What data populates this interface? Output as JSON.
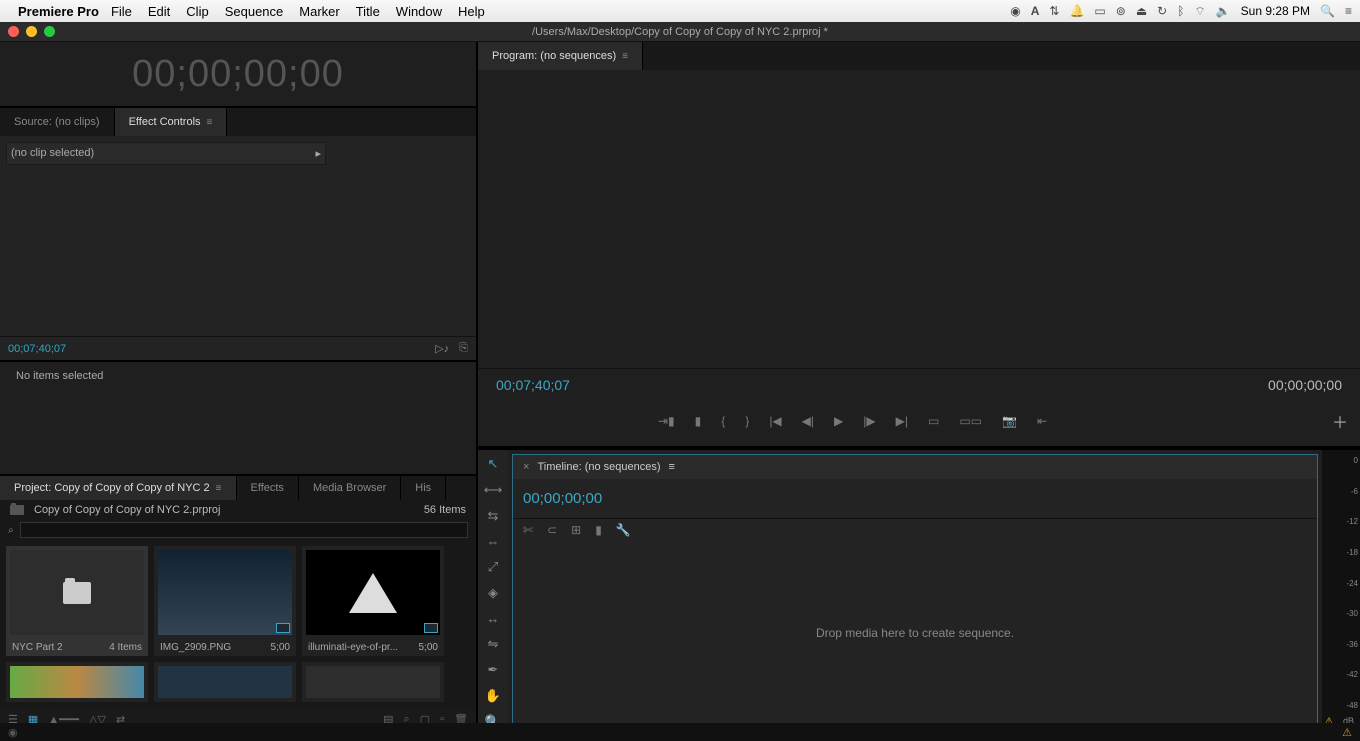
{
  "menubar": {
    "app": "Premiere Pro",
    "items": [
      "File",
      "Edit",
      "Clip",
      "Sequence",
      "Marker",
      "Title",
      "Window",
      "Help"
    ],
    "time": "Sun 9:28 PM"
  },
  "titlebar": {
    "path": "/Users/Max/Desktop/Copy of Copy of Copy of NYC 2.prproj *"
  },
  "source": {
    "tab_source": "Source: (no clips)",
    "tab_fx": "Effect Controls",
    "noclip": "(no clip selected)",
    "time": "00;07;40;07"
  },
  "selection": {
    "text": "No items selected"
  },
  "timecode": {
    "big": "00;00;00;00"
  },
  "program": {
    "tab": "Program: (no sequences)",
    "left_time": "00;07;40;07",
    "right_time": "00;00;00;00"
  },
  "project": {
    "tab_project": "Project: Copy of Copy of Copy of NYC 2",
    "tab_effects": "Effects",
    "tab_media": "Media Browser",
    "tab_hist": "His",
    "filename": "Copy of Copy of Copy of NYC 2.prproj",
    "count": "56 Items",
    "items": [
      {
        "name": "NYC Part 2",
        "meta": "4 Items",
        "type": "folder"
      },
      {
        "name": "IMG_2909.PNG",
        "meta": "5;00",
        "type": "img"
      },
      {
        "name": "illuminati-eye-of-pr...",
        "meta": "5;00",
        "type": "eye"
      }
    ]
  },
  "timeline": {
    "tab": "Timeline: (no sequences)",
    "time": "00;00;00;00",
    "drop": "Drop media here to create sequence."
  },
  "meters": {
    "ticks": [
      "0",
      "-6",
      "-12",
      "-18",
      "-24",
      "-30",
      "-36",
      "-42",
      "-48",
      ""
    ],
    "unit": "dB"
  }
}
